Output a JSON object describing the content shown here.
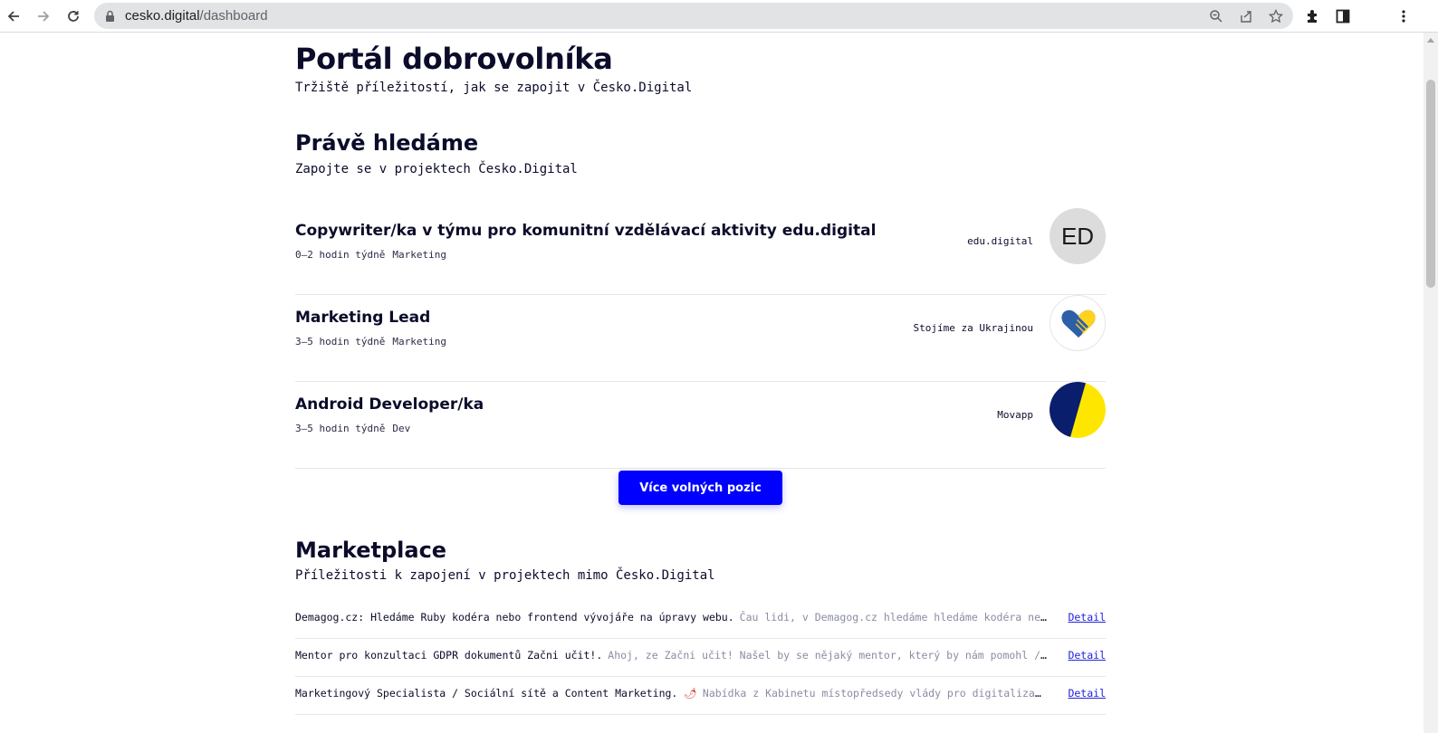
{
  "browser": {
    "url_host": "cesko.digital",
    "url_path": "/dashboard"
  },
  "page": {
    "title": "Portál dobrovolníka",
    "subtitle": "Tržiště příležitostí, jak se zapojit v Česko.Digital"
  },
  "hledame": {
    "title": "Právě hledáme",
    "subtitle": "Zapojte se v projektech Česko.Digital",
    "jobs": [
      {
        "title": "Copywriter/ka v týmu pro komunitní vzdělávací aktivity edu.digital",
        "hours": "0–2 hodin týdně",
        "category": "Marketing",
        "org": "edu.digital",
        "logo_text": "ED"
      },
      {
        "title": "Marketing Lead",
        "hours": "3–5 hodin týdně",
        "category": "Marketing",
        "org": "Stojíme za Ukrajinou"
      },
      {
        "title": "Android Developer/ka",
        "hours": "3–5 hodin týdně",
        "category": "Dev",
        "org": "Movapp"
      }
    ],
    "more_button": "Více volných pozic"
  },
  "marketplace": {
    "title": "Marketplace",
    "subtitle": "Příležitosti k zapojení v projektech mimo Česko.Digital",
    "items": [
      {
        "title": "Demagog.cz: Hledáme Ruby kodéra nebo frontend vývojáře na úpravy webu.",
        "desc": "Čau lidi, v Demagog.cz hledáme hledáme kodéra nebo frontend vývojáře…",
        "detail": "Detail"
      },
      {
        "title": "Mentor pro konzultaci GDPR dokumentů Začni učit!.",
        "desc": "Ahoj, ze Začni učit! Našel by se nějaký mentor, který by nám pomohl /zkonzultoval aktualiza…",
        "detail": "Detail"
      },
      {
        "title": "Marketingový Specialista / Sociální sítě a Content Marketing.",
        "emoji": "🌶",
        "desc": "Nabídka z Kabinetu místopředsedy vlády pro digitalizaci při Úřadu vlády.Ma…",
        "detail": "Detail"
      }
    ]
  },
  "colors": {
    "primary_button": "#0000ff",
    "link": "#2222dd",
    "ukraine_blue": "#0a1e6e",
    "ukraine_yellow": "#ffe600"
  }
}
